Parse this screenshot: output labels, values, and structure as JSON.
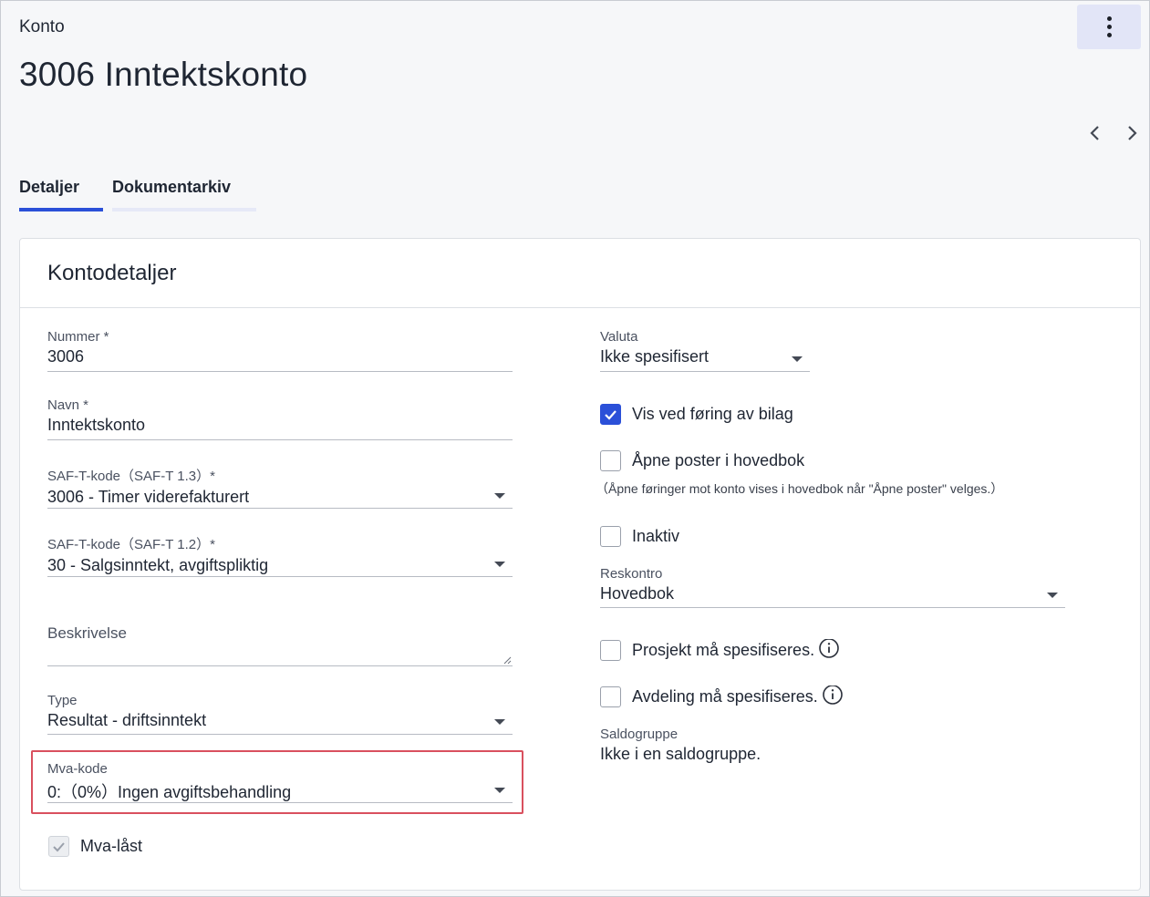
{
  "header": {
    "breadcrumb": "Konto",
    "title": "3006 Inntektskonto",
    "more_icon": "more-vertical-icon",
    "prev_icon": "chevron-left-icon",
    "next_icon": "chevron-right-icon"
  },
  "tabs": [
    {
      "label": "Detaljer",
      "active": true
    },
    {
      "label": "Dokumentarkiv",
      "active": false
    }
  ],
  "colors": {
    "accent": "#2b50d8",
    "highlight": "#d9505e",
    "tab_inactive_bar": "#e6e9f7"
  },
  "card": {
    "title": "Kontodetaljer",
    "left": {
      "nummer": {
        "label": "Nummer *",
        "value": "3006"
      },
      "navn": {
        "label": "Navn *",
        "value": "Inntektskonto"
      },
      "saft13": {
        "label": "SAF-T-kode（SAF-T 1.3）*",
        "value": "3006 - Timer viderefakturert"
      },
      "saft12": {
        "label": "SAF-T-kode（SAF-T 1.2）*",
        "value": "30 - Salgsinntekt, avgiftspliktig"
      },
      "beskrivelse": {
        "label": "Beskrivelse",
        "value": ""
      },
      "type": {
        "label": "Type",
        "value": "Resultat - driftsinntekt"
      },
      "mva_kode": {
        "label": "Mva-kode",
        "value": "0:（0%）Ingen avgiftsbehandling"
      },
      "mva_last": {
        "label": "Mva-låst",
        "checked": true,
        "disabled": true
      }
    },
    "right": {
      "valuta": {
        "label": "Valuta",
        "value": "Ikke spesifisert"
      },
      "vis_ved_foring": {
        "label": "Vis ved føring av bilag",
        "checked": true
      },
      "apne_poster": {
        "label": "Åpne poster i hovedbok",
        "checked": false,
        "hint": "（Åpne føringer mot konto vises i hovedbok når \"Åpne poster\" velges.）"
      },
      "inaktiv": {
        "label": "Inaktiv",
        "checked": false
      },
      "reskontro": {
        "label": "Reskontro",
        "value": "Hovedbok"
      },
      "prosjekt": {
        "label": "Prosjekt må spesifiseres.",
        "checked": false
      },
      "avdeling": {
        "label": "Avdeling må spesifiseres.",
        "checked": false
      },
      "saldogruppe": {
        "label": "Saldogruppe",
        "value": "Ikke i en saldogruppe."
      }
    }
  }
}
